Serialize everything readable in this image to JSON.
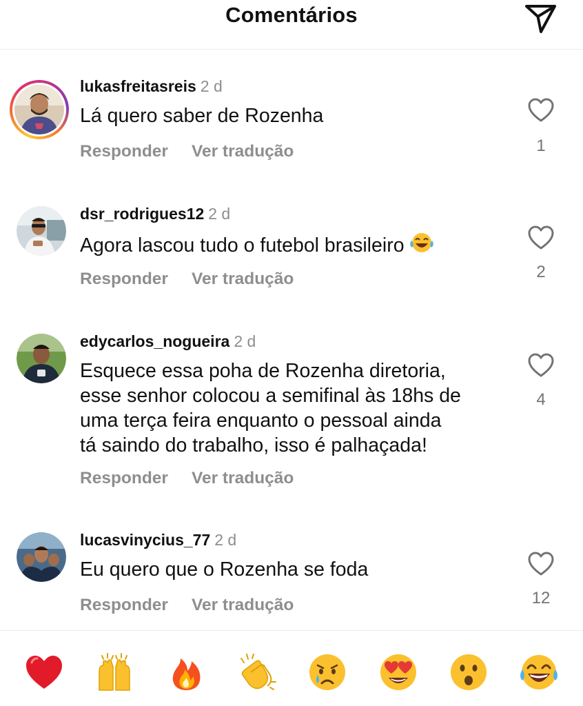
{
  "header": {
    "title": "Comentários"
  },
  "comments": [
    {
      "username": "lukasfreitasreis",
      "time": "2 d",
      "text": "Lá quero saber de Rozenha",
      "reply_label": "Responder",
      "translate_label": "Ver tradução",
      "likes": "1",
      "has_story": true
    },
    {
      "username": "dsr_rodrigues12",
      "time": "2 d",
      "text": "Agora lascou tudo o futebol brasileiro",
      "reply_label": "Responder",
      "translate_label": "Ver tradução",
      "likes": "2",
      "emoji": "face-with-tears-of-joy"
    },
    {
      "username": "edycarlos_nogueira",
      "time": "2 d",
      "text_lines": [
        "Esquece essa poha de Rozenha diretoria,",
        "esse senhor colocou a semifinal às 18hs de",
        "uma terça feira enquanto o pessoal ainda",
        "tá saindo do trabalho, isso é palhaçada!"
      ],
      "reply_label": "Responder",
      "translate_label": "Ver tradução",
      "likes": "4"
    },
    {
      "username": "lucasvinycius_77",
      "time": "2 d",
      "text": "Eu quero que o Rozenha se foda",
      "reply_label": "Responder",
      "translate_label": "Ver tradução",
      "likes": "12"
    }
  ],
  "reactions": [
    "red-heart",
    "raising-hands",
    "fire",
    "clapping-hands",
    "crying-face",
    "heart-eyes-face",
    "surprised-face",
    "face-with-tears-of-joy"
  ],
  "colors": {
    "muted": "#8e8e8e",
    "like_count": "#737373",
    "heart_red": "#e0245e",
    "emoji_yellow": "#fbc02d"
  }
}
